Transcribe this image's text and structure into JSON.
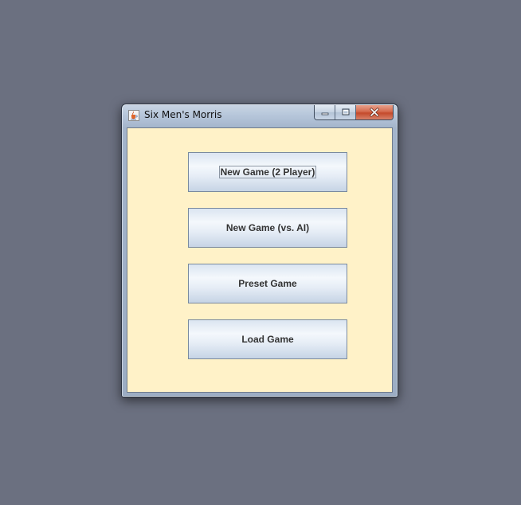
{
  "window": {
    "title": "Six Men's Morris",
    "icon": "java-cup-icon"
  },
  "caption_buttons": {
    "minimize_icon": "minimize-icon",
    "maximize_icon": "maximize-icon",
    "close_icon": "close-icon"
  },
  "menu": {
    "buttons": [
      {
        "label": "New Game (2 Player)",
        "focused": true
      },
      {
        "label": "New Game (vs. AI)",
        "focused": false
      },
      {
        "label": "Preset Game",
        "focused": false
      },
      {
        "label": "Load Game",
        "focused": false
      }
    ]
  },
  "colors": {
    "desktop": "#6b7080",
    "panel_background": "#fff2c8",
    "button_text": "#333333",
    "close_button": "#c44a2c"
  }
}
